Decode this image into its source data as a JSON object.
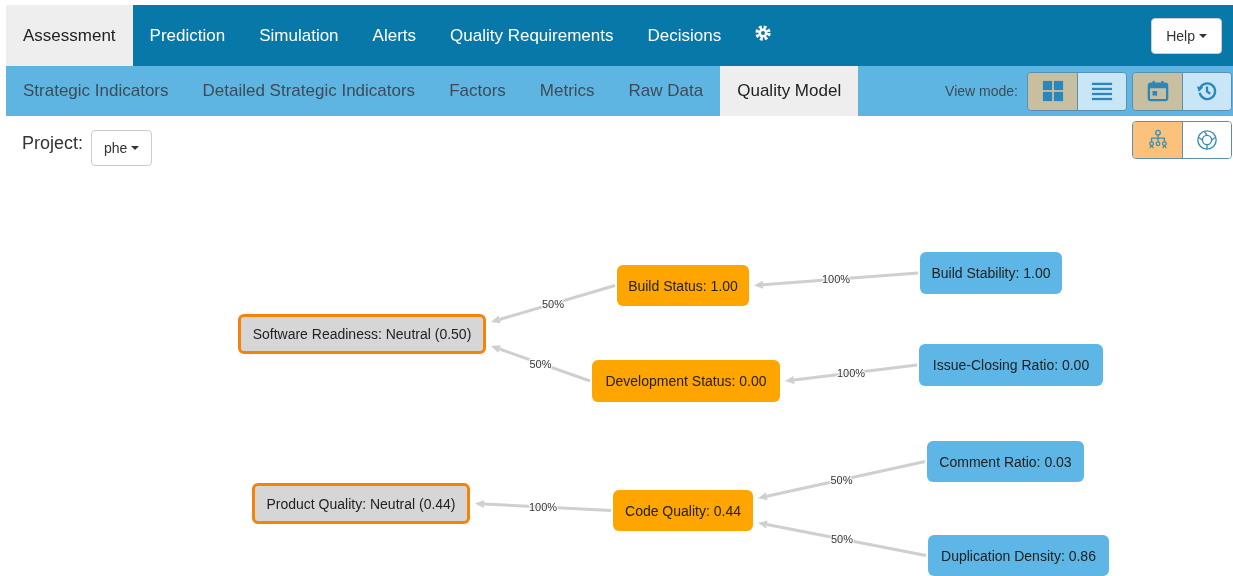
{
  "main_tabs": [
    {
      "label": "Assessment",
      "selected": true
    },
    {
      "label": "Prediction",
      "selected": false
    },
    {
      "label": "Simulation",
      "selected": false
    },
    {
      "label": "Alerts",
      "selected": false
    },
    {
      "label": "Quality Requirements",
      "selected": false
    },
    {
      "label": "Decisions",
      "selected": false
    }
  ],
  "help_button": {
    "label": "Help"
  },
  "sub_tabs": [
    {
      "label": "Strategic Indicators",
      "selected": false
    },
    {
      "label": "Detailed Strategic Indicators",
      "selected": false
    },
    {
      "label": "Factors",
      "selected": false
    },
    {
      "label": "Metrics",
      "selected": false
    },
    {
      "label": "Raw Data",
      "selected": false
    },
    {
      "label": "Quality Model",
      "selected": true
    }
  ],
  "view_mode": {
    "label": "View mode:",
    "groups": [
      [
        {
          "kind": "grid",
          "selected": true
        },
        {
          "kind": "list",
          "selected": false
        }
      ],
      [
        {
          "kind": "calendar",
          "selected": true
        },
        {
          "kind": "history",
          "selected": false
        }
      ]
    ]
  },
  "project": {
    "label": "Project:",
    "value": "phe"
  },
  "graph_views": [
    {
      "kind": "tree",
      "selected": true
    },
    {
      "kind": "circle",
      "selected": false
    }
  ],
  "quality_model": [
    {
      "kind": "strategic",
      "label": "Software Readiness: Neutral (0.50)",
      "children": [
        {
          "kind": "factor",
          "label": "Build Status: 1.00",
          "weight": "50%",
          "children": [
            {
              "kind": "metric",
              "label": "Build Stability: 1.00",
              "weight": "100%"
            }
          ]
        },
        {
          "kind": "factor",
          "label": "Development Status: 0.00",
          "weight": "50%",
          "children": [
            {
              "kind": "metric",
              "label": "Issue-Closing Ratio: 0.00",
              "weight": "100%"
            }
          ]
        }
      ]
    },
    {
      "kind": "strategic",
      "label": "Product Quality: Neutral (0.44)",
      "children": [
        {
          "kind": "factor",
          "label": "Code Quality: 0.44",
          "weight": "100%",
          "children": [
            {
              "kind": "metric",
              "label": "Comment Ratio: 0.03",
              "weight": "50%"
            },
            {
              "kind": "metric",
              "label": "Duplication Density: 0.86",
              "weight": "50%"
            }
          ]
        }
      ]
    }
  ]
}
